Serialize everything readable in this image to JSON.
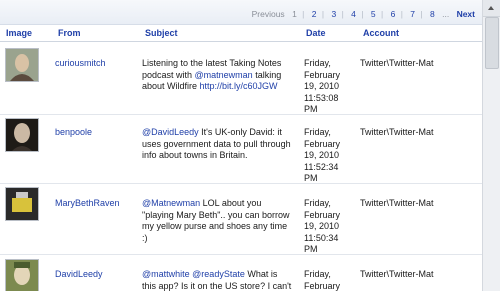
{
  "pager": {
    "previous": "Previous",
    "current": "1",
    "pages": [
      "2",
      "3",
      "4",
      "5",
      "6",
      "7",
      "8"
    ],
    "ellipsis": "...",
    "next": "Next"
  },
  "columns": {
    "image": "Image",
    "from": "From",
    "subject": "Subject",
    "date": "Date",
    "account": "Account"
  },
  "rows": [
    {
      "from": "curiousmitch",
      "subject_pre": "Listening to the latest Taking Notes podcast with ",
      "subject_link1": "@matnewman",
      "subject_mid": " talking about Wildfire ",
      "subject_link2": "http://bit.ly/c60JGW",
      "subject_post": "",
      "date": [
        "Friday,",
        "February",
        "19, 2010",
        "11:53:08",
        "PM"
      ],
      "account": "Twitter\\Twitter-Mat",
      "avatar_colors": [
        "#9aa38e",
        "#5b4b3e",
        "#d9c2a5"
      ]
    },
    {
      "from": "benpoole",
      "subject_pre": "",
      "subject_link1": "@DavidLeedy",
      "subject_mid": " It's UK-only David: it uses government data to pull through info about towns in Britain.",
      "subject_link2": "",
      "subject_post": "",
      "date": [
        "Friday,",
        "February",
        "19, 2010",
        "11:52:34",
        "PM"
      ],
      "account": "Twitter\\Twitter-Mat",
      "avatar_colors": [
        "#1e1b17",
        "#cbb9a4",
        "#3a322c"
      ]
    },
    {
      "from": "MaryBethRaven",
      "subject_pre": "",
      "subject_link1": "@Matnewman",
      "subject_mid": " LOL about you \"playing Mary Beth\".. you can borrow my yellow purse and shoes any time :)",
      "subject_link2": "",
      "subject_post": "",
      "date": [
        "Friday,",
        "February",
        "19, 2010",
        "11:50:34",
        "PM"
      ],
      "account": "Twitter\\Twitter-Mat",
      "avatar_colors": [
        "#2a2a2a",
        "#d8c23b",
        "#c9c9c9"
      ]
    },
    {
      "from": "DavidLeedy",
      "subject_pre": "",
      "subject_link1": "@mattwhite",
      "subject_mid": " ",
      "subject_link2": "@readyState",
      "subject_post": " What is this app? Is it on the US store? I can't",
      "date": [
        "Friday,",
        "February"
      ],
      "account": "Twitter\\Twitter-Mat",
      "avatar_colors": [
        "#7c8a4f",
        "#e3d6b8",
        "#4a5c2e"
      ]
    }
  ]
}
